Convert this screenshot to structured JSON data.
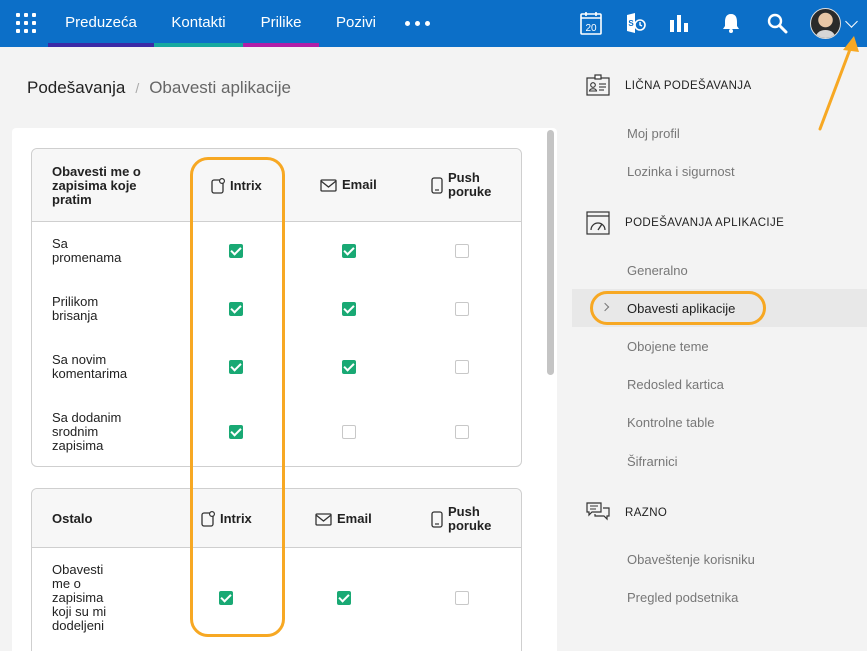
{
  "nav": {
    "tabs": [
      {
        "label": "Preduzeća",
        "color": "#3b2aa6"
      },
      {
        "label": "Kontakti",
        "color": "#16a9a0"
      },
      {
        "label": "Prilike",
        "color": "#b01ea8"
      },
      {
        "label": "Pozivi",
        "color": "#0c6fc8"
      }
    ],
    "calendar_day": "20",
    "icons": [
      "apps-grid-icon",
      "more-dots-icon",
      "calendar-icon",
      "phone-history-icon",
      "bar-chart-icon",
      "bell-icon",
      "search-icon",
      "avatar",
      "chevron-down-icon"
    ]
  },
  "breadcrumb": {
    "root": "Podešavanja",
    "separator": "/",
    "current": "Obavesti aplikacije"
  },
  "table1": {
    "title": "Obavesti me o zapisima koje pratim",
    "columns": [
      {
        "label": "Intrix",
        "icon": "intrix-icon"
      },
      {
        "label": "Email",
        "icon": "mail-icon"
      },
      {
        "label": "Push poruke",
        "icon": "mobile-icon"
      }
    ],
    "rows": [
      {
        "label": "Sa promenama",
        "intrix": true,
        "email": true,
        "push": false
      },
      {
        "label": "Prilikom brisanja",
        "intrix": true,
        "email": true,
        "push": false
      },
      {
        "label": "Sa novim komentarima",
        "intrix": true,
        "email": true,
        "push": false
      },
      {
        "label": "Sa dodanim srodnim zapisima",
        "intrix": true,
        "email": false,
        "push": false
      }
    ]
  },
  "table2": {
    "title": "Ostalo",
    "columns": [
      {
        "label": "Intrix",
        "icon": "intrix-icon"
      },
      {
        "label": "Email",
        "icon": "mail-icon"
      },
      {
        "label": "Push poruke",
        "icon": "mobile-icon"
      }
    ],
    "rows": [
      {
        "label": "Obavesti me o zapisima koji su mi dodeljeni",
        "intrix": true,
        "email": true,
        "push": false
      }
    ]
  },
  "sidebar": {
    "sections": [
      {
        "title": "LIČNA PODEŠAVANJA",
        "icon": "id-card-icon",
        "items": [
          "Moj profil",
          "Lozinka i sigurnost"
        ]
      },
      {
        "title": "PODEŠAVANJA APLIKACIJE",
        "icon": "gauge-window-icon",
        "items": [
          "Generalno",
          "Obavesti aplikacije",
          "Obojene teme",
          "Redosled kartica",
          "Kontrolne table",
          "Šifrarnici"
        ]
      },
      {
        "title": "RAZNO",
        "icon": "chat-bubbles-icon",
        "items": [
          "Obaveštenje korisniku",
          "Pregled podsetnika"
        ]
      }
    ],
    "active_item": "Obavesti aplikacije"
  },
  "colors": {
    "topbar": "#0c6fc8",
    "checkbox_on": "#19a974",
    "highlight": "#f7a823"
  }
}
